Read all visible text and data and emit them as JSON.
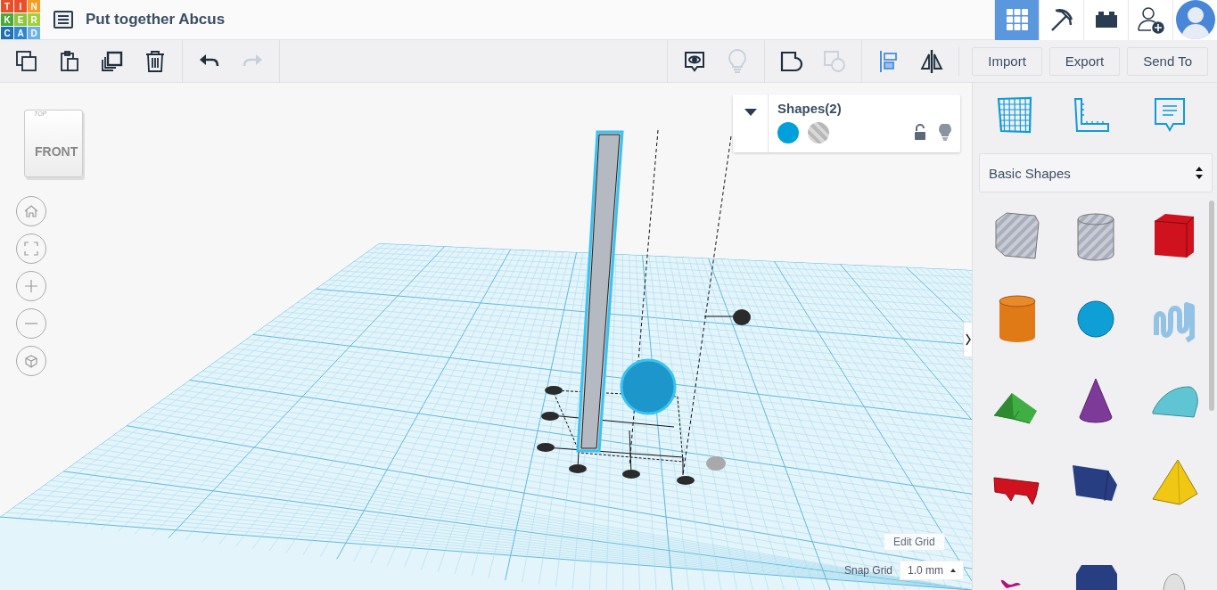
{
  "logo": {
    "letters": [
      "T",
      "I",
      "N",
      "K",
      "E",
      "R",
      "C",
      "A",
      "D"
    ]
  },
  "header": {
    "title": "Put together Abcus",
    "views": [
      {
        "kind": "grid",
        "selected": true
      },
      {
        "kind": "pickaxe",
        "selected": false
      },
      {
        "kind": "brick",
        "selected": false
      },
      {
        "kind": "add-user",
        "selected": false
      },
      {
        "kind": "avatar",
        "selected": false
      }
    ]
  },
  "toolbar": {
    "left_groups": [
      [
        {
          "kind": "copy",
          "disabled": false
        },
        {
          "kind": "paste",
          "disabled": false
        },
        {
          "kind": "duplicate",
          "disabled": false
        },
        {
          "kind": "delete",
          "disabled": false
        }
      ],
      [
        {
          "kind": "undo",
          "disabled": false
        },
        {
          "kind": "redo",
          "disabled": true
        }
      ]
    ],
    "right_groups": [
      [
        {
          "kind": "note",
          "disabled": false
        },
        {
          "kind": "bulb",
          "disabled": true
        }
      ],
      [
        {
          "kind": "group",
          "disabled": false
        },
        {
          "kind": "ungroup",
          "disabled": true
        }
      ],
      [
        {
          "kind": "align",
          "disabled": false
        },
        {
          "kind": "mirror",
          "disabled": false
        }
      ]
    ],
    "buttons": [
      "Import",
      "Export",
      "Send To"
    ]
  },
  "view_cube": {
    "top": "TOP",
    "front": "FRONT"
  },
  "view_controls": [
    {
      "kind": "home"
    },
    {
      "kind": "fit"
    },
    {
      "kind": "zoom-in"
    },
    {
      "kind": "zoom-out"
    },
    {
      "kind": "perspective"
    }
  ],
  "inspector": {
    "title": "Shapes(2)",
    "swatches": [
      {
        "kind": "solid",
        "color": "#00a0dc"
      },
      {
        "kind": "hole",
        "color": "#b8b8b8"
      }
    ],
    "locked": false
  },
  "grid_controls": {
    "edit": "Edit Grid",
    "snap_label": "Snap Grid",
    "snap_value": "1.0 mm"
  },
  "panel": {
    "tabs": [
      {
        "kind": "workplane"
      },
      {
        "kind": "ruler"
      },
      {
        "kind": "notes"
      }
    ],
    "category": "Basic Shapes",
    "shapes": [
      {
        "kind": "box-hole",
        "color": "#c8ccd6"
      },
      {
        "kind": "cylinder-hole",
        "color": "#c8ccd6"
      },
      {
        "kind": "box",
        "color": "#d0121f"
      },
      {
        "kind": "cylinder",
        "color": "#e07a17"
      },
      {
        "kind": "sphere",
        "color": "#0d9fd6"
      },
      {
        "kind": "scribble",
        "color": "#92c3e6"
      },
      {
        "kind": "roof",
        "color": "#3fae43"
      },
      {
        "kind": "cone",
        "color": "#7e3a98"
      },
      {
        "kind": "round-roof",
        "color": "#60c5d2"
      },
      {
        "kind": "text",
        "color": "#d0121f"
      },
      {
        "kind": "prism",
        "color": "#283e82"
      },
      {
        "kind": "pyramid",
        "color": "#f0c814"
      },
      {
        "kind": "heart",
        "color": "#b0147a"
      },
      {
        "kind": "hexagon",
        "color": "#283e82"
      },
      {
        "kind": "paraboloid",
        "color": "#e0e0e0"
      }
    ]
  }
}
